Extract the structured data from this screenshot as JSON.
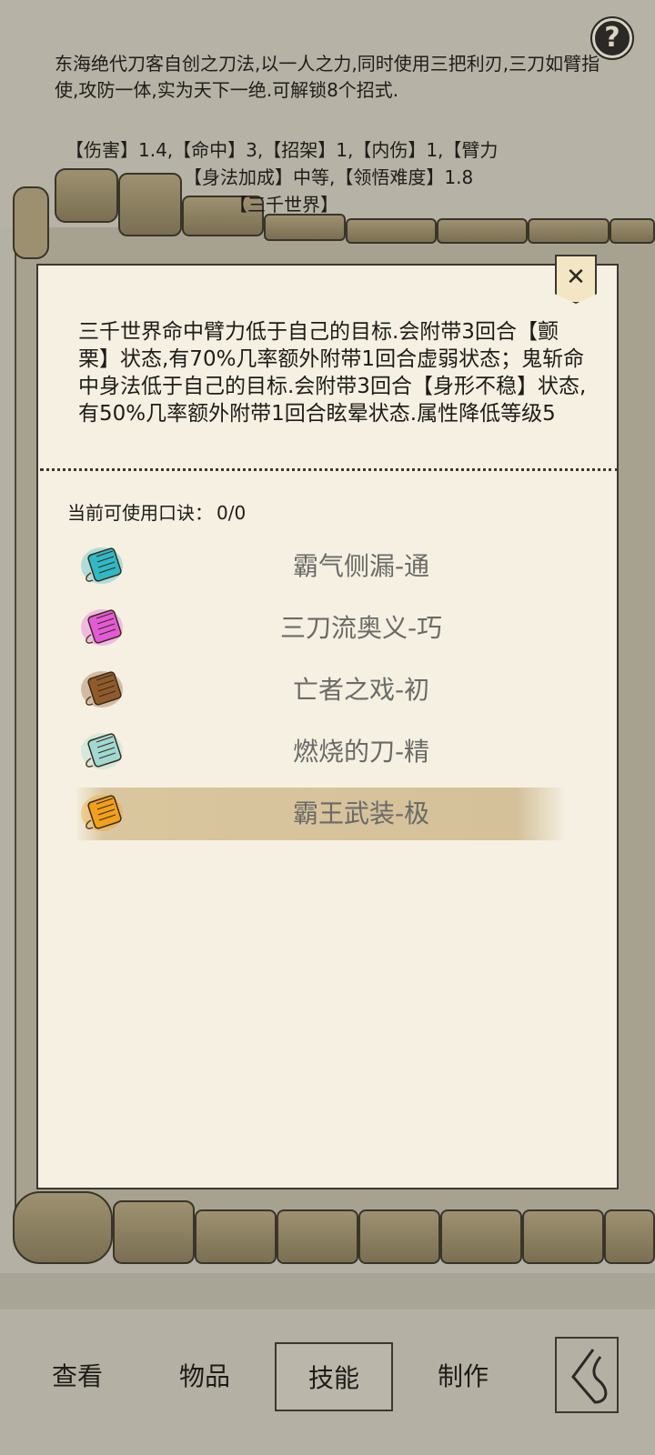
{
  "background": {
    "description_text": "东海绝代刀客自创之刀法,以一人之力,同时使用三把利刃,三刀如臂指使,攻防一体,实为天下一绝.可解锁8个招式.",
    "stats_line1": "【伤害】1.4,【命中】3,【招架】1,【内伤】1,【臂力",
    "stats_line2": "【身法加成】中等,【领悟难度】1.8",
    "stats_line3": "【三千世界】",
    "help_icon": "?"
  },
  "popup": {
    "close_icon": "✕",
    "description": "三千世界命中臂力低于自己的目标.会附带3回合【颤栗】状态,有70%几率额外附带1回合虚弱状态；鬼斩命中身法低于自己的目标.会附带3回合【身形不稳】状态,有50%几率额外附带1回合眩晕状态.属性降低等级5",
    "formula_count_label": "当前可使用口诀：",
    "formula_count_value": "0/0",
    "items": [
      {
        "label": "霸气侧漏-通",
        "icon": "scroll-icon",
        "color": "#2fb9c6"
      },
      {
        "label": "三刀流奥义-巧",
        "icon": "scroll-icon",
        "color": "#e35ad7"
      },
      {
        "label": "亡者之戏-初",
        "icon": "scroll-icon",
        "color": "#8f5b2c"
      },
      {
        "label": "燃烧的刀-精",
        "icon": "scroll-icon",
        "color": "#9fd9d2"
      },
      {
        "label": "霸王武装-极",
        "icon": "scroll-icon",
        "color": "#f0a019"
      }
    ]
  },
  "nav": {
    "view": "查看",
    "items": "物品",
    "skills": "技能",
    "craft": "制作",
    "back_icon": "back-icon"
  }
}
